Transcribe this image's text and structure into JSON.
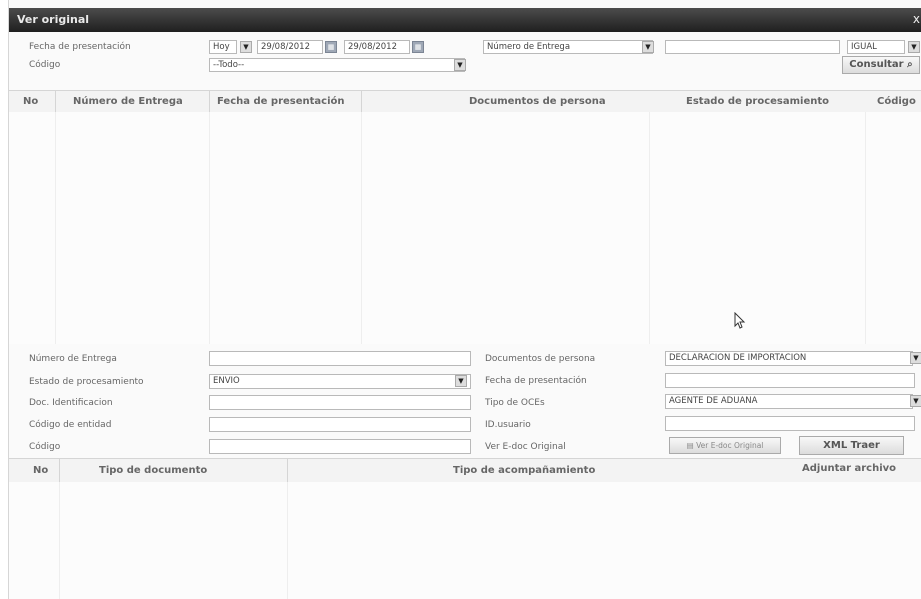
{
  "window": {
    "title": "Ver original",
    "close_glyph": "x"
  },
  "filters": {
    "fecha_label": "Fecha de presentación",
    "fecha_type": "Hoy",
    "fecha_from": "29/08/2012",
    "fecha_to": "29/08/2012",
    "search_field": "Número de Entrega",
    "search_value": "",
    "operator": "IGUAL",
    "codigo_label": "Código",
    "codigo_value": "--Todo--",
    "consultar_label": "Consultar"
  },
  "grid1": {
    "headers": [
      "No",
      "Número de Entrega",
      "Fecha de presentación",
      "Documentos de persona",
      "Estado de procesamiento",
      "Código"
    ],
    "rows": []
  },
  "form": {
    "numero_entrega_label": "Número de Entrega",
    "numero_entrega_value": "",
    "estado_label": "Estado de procesamiento",
    "estado_value": "ENVIO",
    "doc_ident_label": "Doc. Identificacion",
    "doc_ident_value": "",
    "codigo_entidad_label": "Código de entidad",
    "codigo_entidad_value": "",
    "codigo_label": "Código",
    "codigo_value": "",
    "doc_persona_label": "Documentos de persona",
    "doc_persona_value": "DECLARACION DE IMPORTACION",
    "fecha_label": "Fecha de presentación",
    "fecha_value": "",
    "tipo_oce_label": "Tipo de OCEs",
    "tipo_oce_value": "AGENTE DE ADUANA",
    "id_usuario_label": "ID.usuario",
    "id_usuario_value": "",
    "ver_edoc_label": "Ver E-doc Original",
    "ver_edoc_button": "Ver E-doc Original",
    "xml_button": "XML Traer"
  },
  "grid2": {
    "headers": [
      "No",
      "Tipo de documento",
      "Tipo de acompañamiento",
      "Adjuntar archivo"
    ],
    "rows": []
  }
}
